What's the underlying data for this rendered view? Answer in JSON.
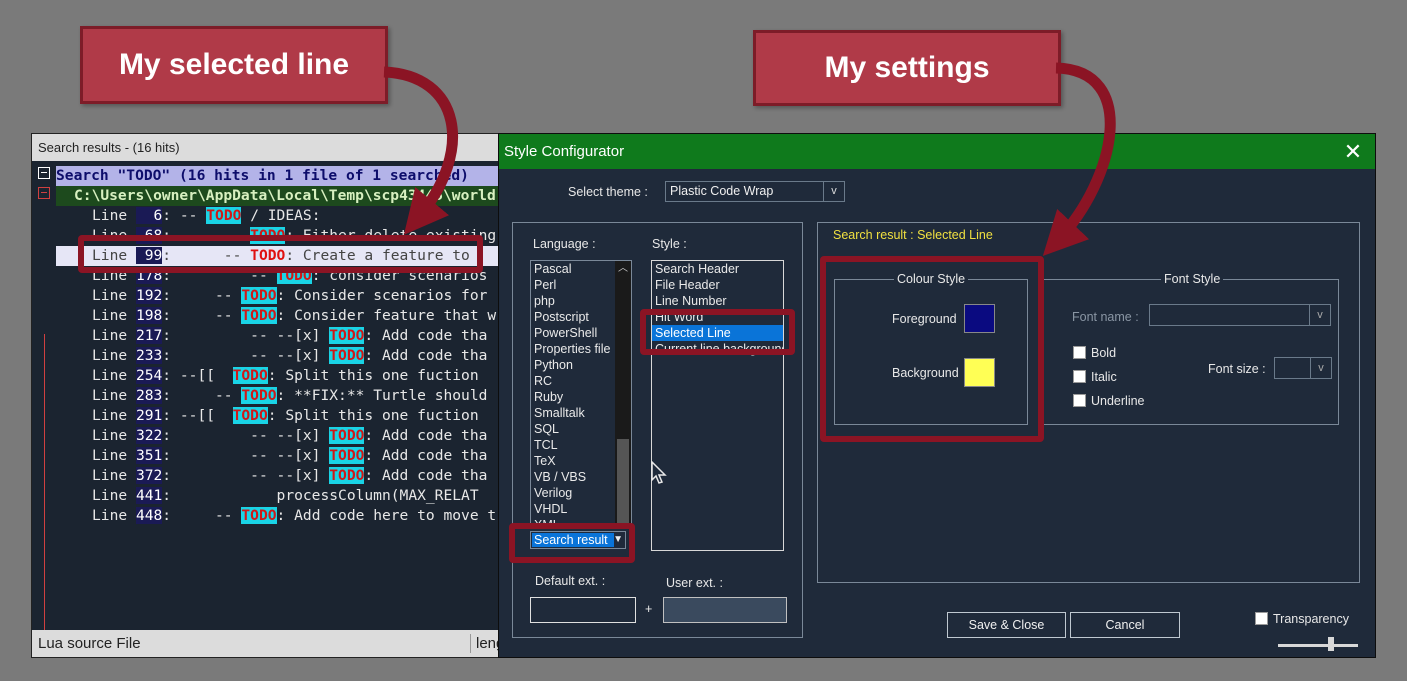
{
  "annotations": {
    "left_callout": "My selected line",
    "right_callout": "My settings"
  },
  "search_panel": {
    "title": "Search results - (16 hits)",
    "header": "Search \"TODO\" (16 hits in 1 file of 1 searched)",
    "file_path": "C:\\Users\\owner\\AppData\\Local\\Temp\\scp43445\\world",
    "todo_word": "TODO",
    "lines": [
      {
        "num": "  6",
        "pre": " -- ",
        "post": " / IDEAS:",
        "selected": false
      },
      {
        "num": " 68",
        "pre": "         ",
        "post": ": Either delete existing",
        "selected": false
      },
      {
        "num": " 99",
        "pre": "      -- ",
        "post": ": Create a feature to",
        "selected": true
      },
      {
        "num": "178",
        "pre": "         -- ",
        "post": ": consider scenarios",
        "selected": false
      },
      {
        "num": "192",
        "pre": "     -- ",
        "post": ": Consider scenarios for",
        "selected": false
      },
      {
        "num": "198",
        "pre": "     -- ",
        "post": ": Consider feature that w",
        "selected": false
      },
      {
        "num": "217",
        "pre": "         -- --[x] ",
        "post": ": Add code tha",
        "selected": false
      },
      {
        "num": "233",
        "pre": "         -- --[x] ",
        "post": ": Add code tha",
        "selected": false
      },
      {
        "num": "254",
        "pre": " --[[  ",
        "post": ": Split this one fuction",
        "selected": false
      },
      {
        "num": "283",
        "pre": "     -- ",
        "post": ": **FIX:** Turtle should",
        "selected": false
      },
      {
        "num": "291",
        "pre": " --[[  ",
        "post": ": Split this one fuction",
        "selected": false
      },
      {
        "num": "322",
        "pre": "         -- --[x] ",
        "post": ": Add code tha",
        "selected": false
      },
      {
        "num": "351",
        "pre": "         -- --[x] ",
        "post": ": Add code tha",
        "selected": false
      },
      {
        "num": "372",
        "pre": "         -- --[x] ",
        "post": ": Add code tha",
        "selected": false
      },
      {
        "num": "441",
        "pre": "            processColumn(MAX_RELAT",
        "post": "",
        "selected": false,
        "no_todo": true
      },
      {
        "num": "448",
        "pre": "     -- ",
        "post": ": Add code here to move t",
        "selected": false
      }
    ],
    "line_word": "Line ",
    "status_left": "Lua source File",
    "status_right": "leng"
  },
  "dialog": {
    "title": "Style Configurator",
    "close_glyph": "✕",
    "theme_label": "Select theme :",
    "theme_value": "Plastic Code Wrap",
    "dropdown_glyph": "v",
    "language_label": "Language :",
    "style_label": "Style :",
    "languages": [
      "Pascal",
      "Perl",
      "php",
      "Postscript",
      "PowerShell",
      "Properties file",
      "Python",
      "RC",
      "Ruby",
      "Smalltalk",
      "SQL",
      "TCL",
      "TeX",
      "VB / VBS",
      "Verilog",
      "VHDL",
      "XML"
    ],
    "language_combo_value": "Search result",
    "styles": [
      "Search Header",
      "File Header",
      "Line Number",
      "Hit Word",
      "Selected Line",
      "Current line background"
    ],
    "selected_style_index": 4,
    "default_ext_label": "Default ext. :",
    "user_ext_label": "User ext. :",
    "plus": "+",
    "style_heading": "Search result : Selected Line",
    "colour_style_label": "Colour Style",
    "foreground_label": "Foreground",
    "background_label": "Background",
    "foreground_color": "#0a0a80",
    "background_color": "#ffff55",
    "font_style_label": "Font Style",
    "font_name_label": "Font name :",
    "font_size_label": "Font size :",
    "bold_label": "Bold",
    "italic_label": "Italic",
    "underline_label": "Underline",
    "save_close_label": "Save & Close",
    "cancel_label": "Cancel",
    "transparency_label": "Transparency"
  }
}
